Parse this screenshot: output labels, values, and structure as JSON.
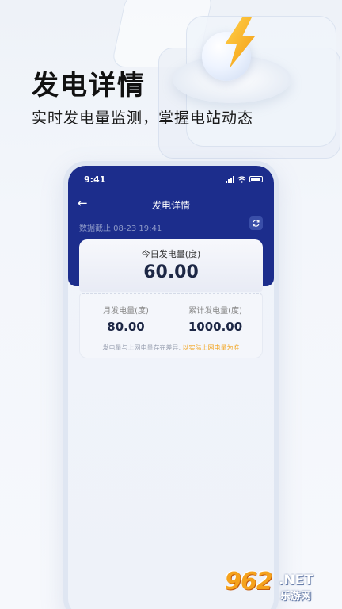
{
  "promo": {
    "headline": "发电详情",
    "subline": "实时发电量监测，掌握电站动态"
  },
  "statusbar": {
    "time": "9:41"
  },
  "nav": {
    "back_icon": "←",
    "title": "发电详情"
  },
  "data_cutoff": "数据截止 08-23 19:41",
  "today": {
    "label": "今日发电量(度)",
    "value": "60.00"
  },
  "stats": {
    "month": {
      "label": "月发电量(度)",
      "value": "80.00"
    },
    "total": {
      "label": "累计发电量(度)",
      "value": "1000.00"
    }
  },
  "note": {
    "text": "发电量与上网电量存在差异, ",
    "highlight": "以实际上网电量为准"
  },
  "watermark": {
    "num": "962",
    "net": ".NET",
    "cn": "乐游网"
  },
  "colors": {
    "header": "#1c2d8c",
    "accent": "#f2a623",
    "bolt": "#f7b318"
  }
}
